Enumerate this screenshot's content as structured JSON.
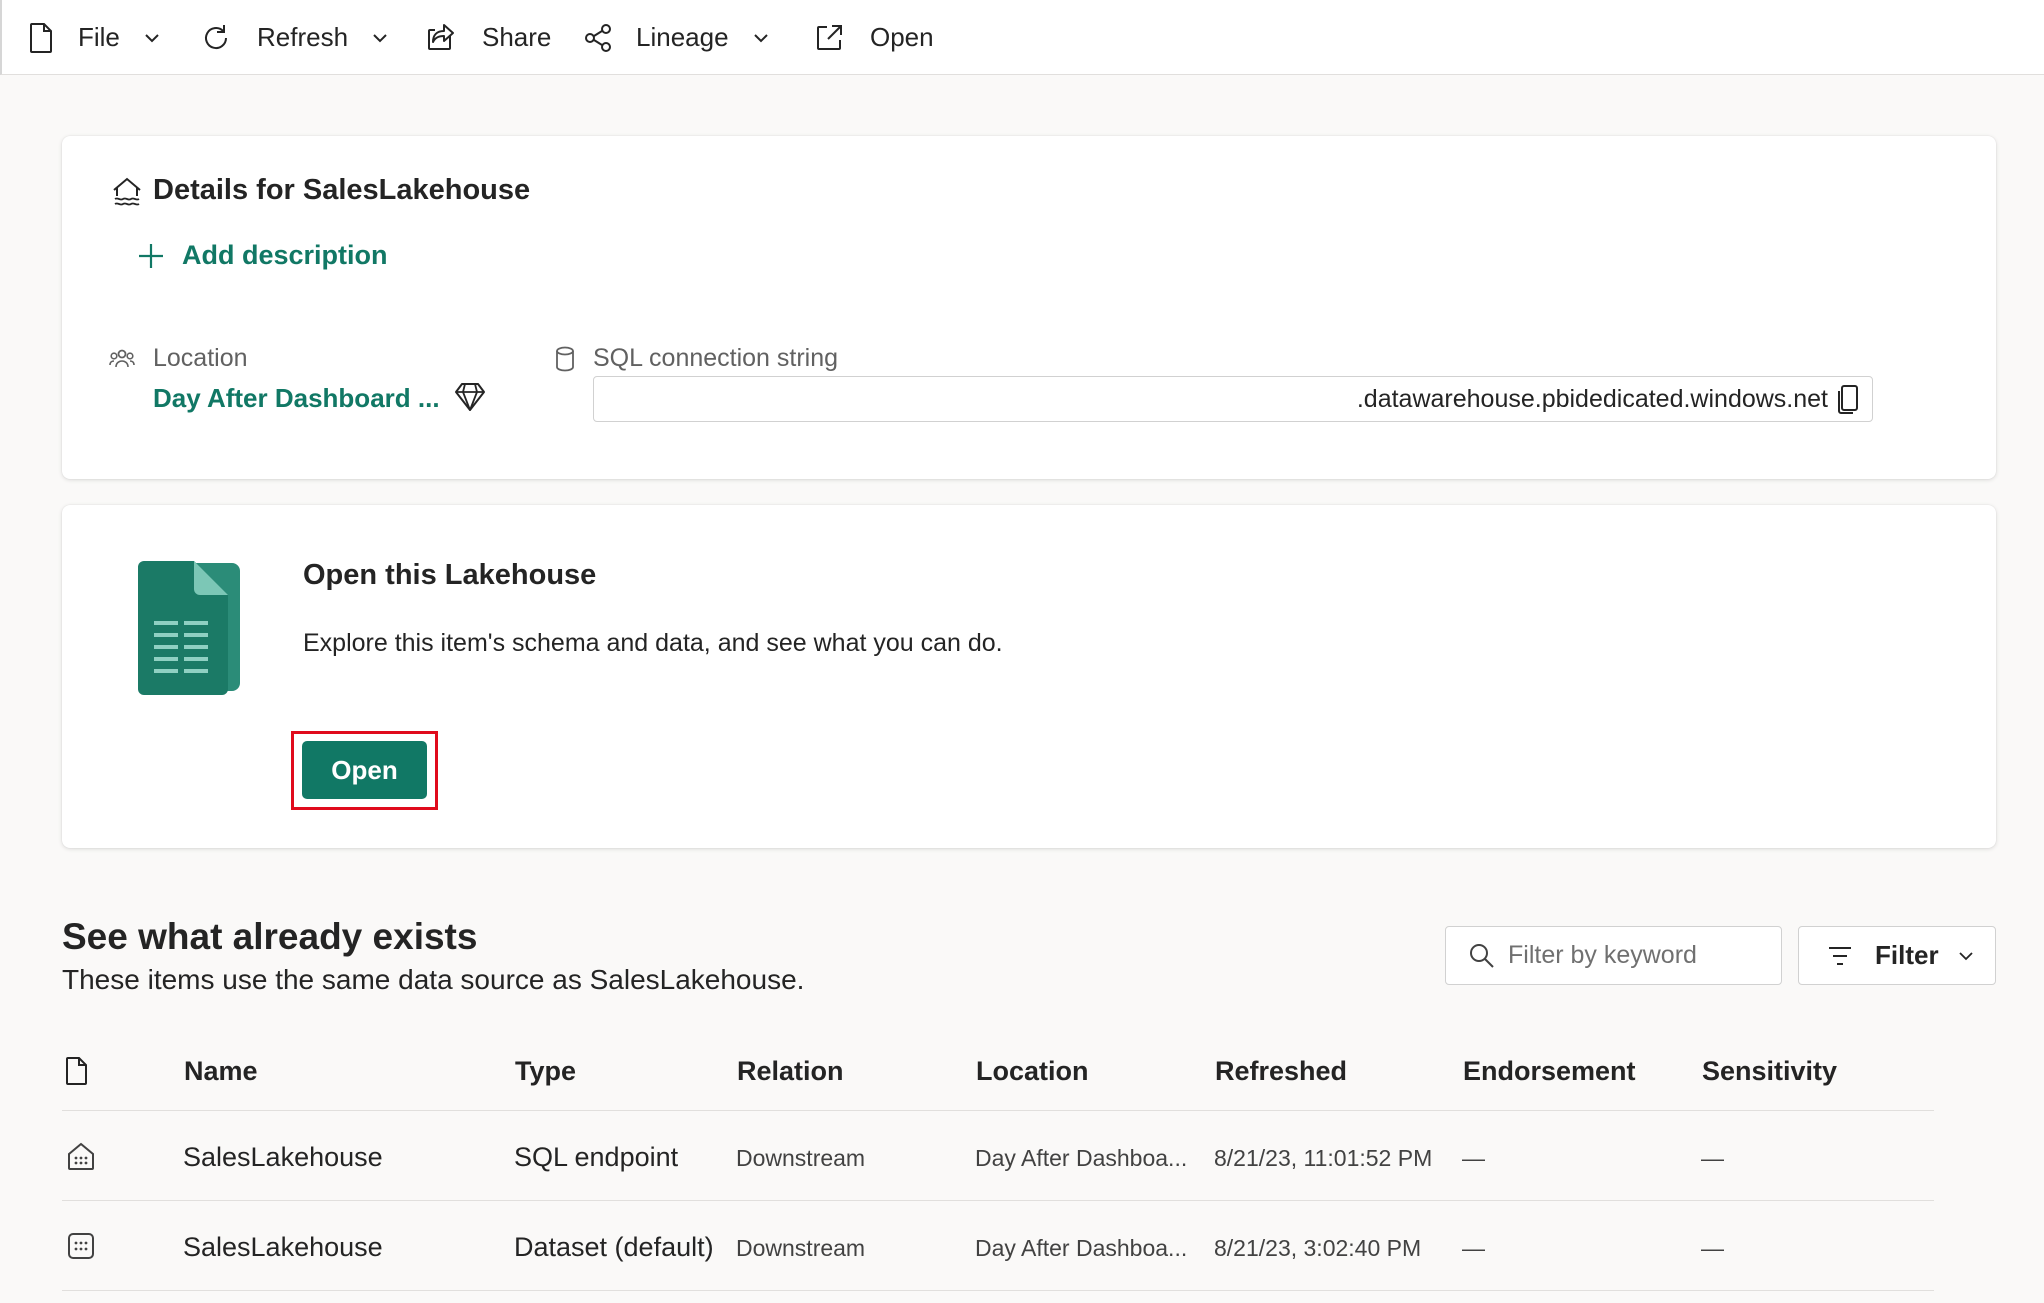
{
  "toolbar": {
    "file_label": "File",
    "refresh_label": "Refresh",
    "share_label": "Share",
    "lineage_label": "Lineage",
    "open_label": "Open"
  },
  "details": {
    "title": "Details for SalesLakehouse",
    "add_description": "Add description",
    "location_label": "Location",
    "location_value": "Day After Dashboard ...",
    "sql_label": "SQL connection string",
    "sql_value": ".datawarehouse.pbidedicated.windows.net"
  },
  "open_card": {
    "title": "Open this Lakehouse",
    "description": "Explore this item's schema and data, and see what you can do.",
    "button": "Open"
  },
  "existing": {
    "title": "See what already exists",
    "subtitle": "These items use the same data source as SalesLakehouse.",
    "search_placeholder": "Filter by keyword",
    "filter_label": "Filter"
  },
  "table": {
    "headers": {
      "name": "Name",
      "type": "Type",
      "relation": "Relation",
      "location": "Location",
      "refreshed": "Refreshed",
      "endorsement": "Endorsement",
      "sensitivity": "Sensitivity"
    },
    "rows": [
      {
        "icon": "sql-endpoint-icon",
        "name": "SalesLakehouse",
        "type": "SQL endpoint",
        "relation": "Downstream",
        "location": "Day After Dashboa...",
        "refreshed": "8/21/23, 11:01:52 PM",
        "endorsement": "—",
        "sensitivity": "—"
      },
      {
        "icon": "dataset-icon",
        "name": "SalesLakehouse",
        "type": "Dataset (default)",
        "relation": "Downstream",
        "location": "Day After Dashboa...",
        "refreshed": "8/21/23, 3:02:40 PM",
        "endorsement": "—",
        "sensitivity": "—"
      }
    ]
  },
  "colors": {
    "accent": "#117865",
    "highlight": "#e00b1c"
  }
}
